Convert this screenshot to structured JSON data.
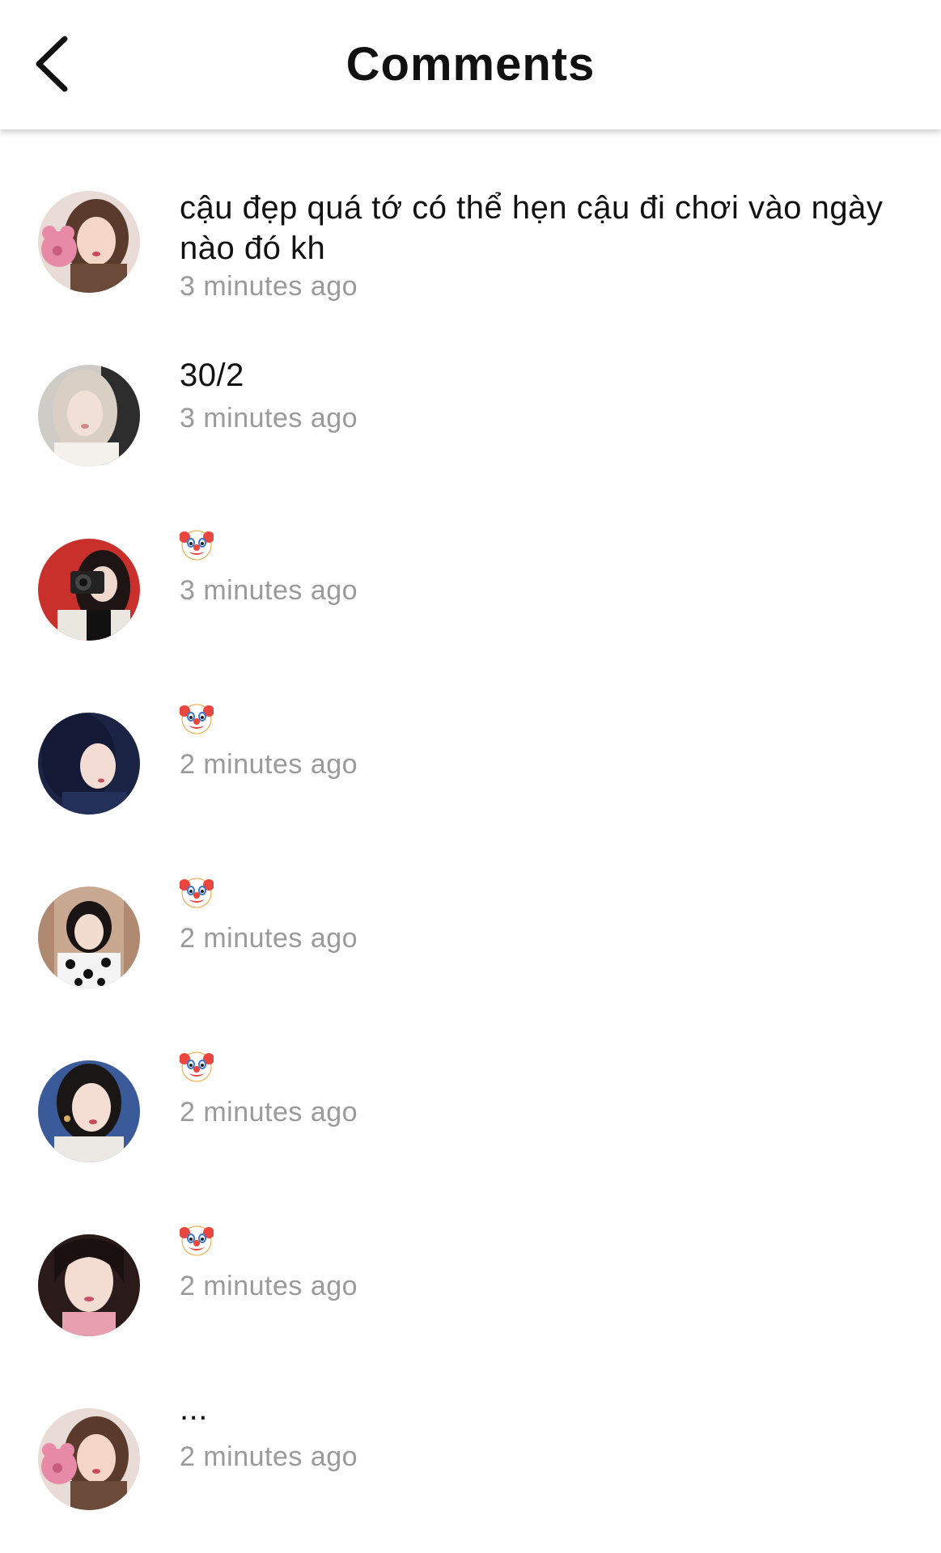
{
  "header": {
    "title": "Comments",
    "back_icon": "chevron-left-icon"
  },
  "colors": {
    "text": "#111111",
    "timestamp": "#9a9a9a",
    "background": "#ffffff"
  },
  "comments": [
    {
      "text": "cậu đẹp quá tớ có thể hẹn cậu đi chơi vào ngày nào đó kh",
      "time": "3 minutes ago",
      "emoji": null
    },
    {
      "text": "30/2",
      "time": "3 minutes ago",
      "emoji": null
    },
    {
      "text": "",
      "time": "3 minutes ago",
      "emoji": "clown-face-icon"
    },
    {
      "text": "",
      "time": "2 minutes ago",
      "emoji": "clown-face-icon"
    },
    {
      "text": "",
      "time": "2 minutes ago",
      "emoji": "clown-face-icon"
    },
    {
      "text": "",
      "time": "2 minutes ago",
      "emoji": "clown-face-icon"
    },
    {
      "text": "",
      "time": "2 minutes ago",
      "emoji": "clown-face-icon"
    },
    {
      "text": "...",
      "time": "2 minutes ago",
      "emoji": null
    }
  ]
}
